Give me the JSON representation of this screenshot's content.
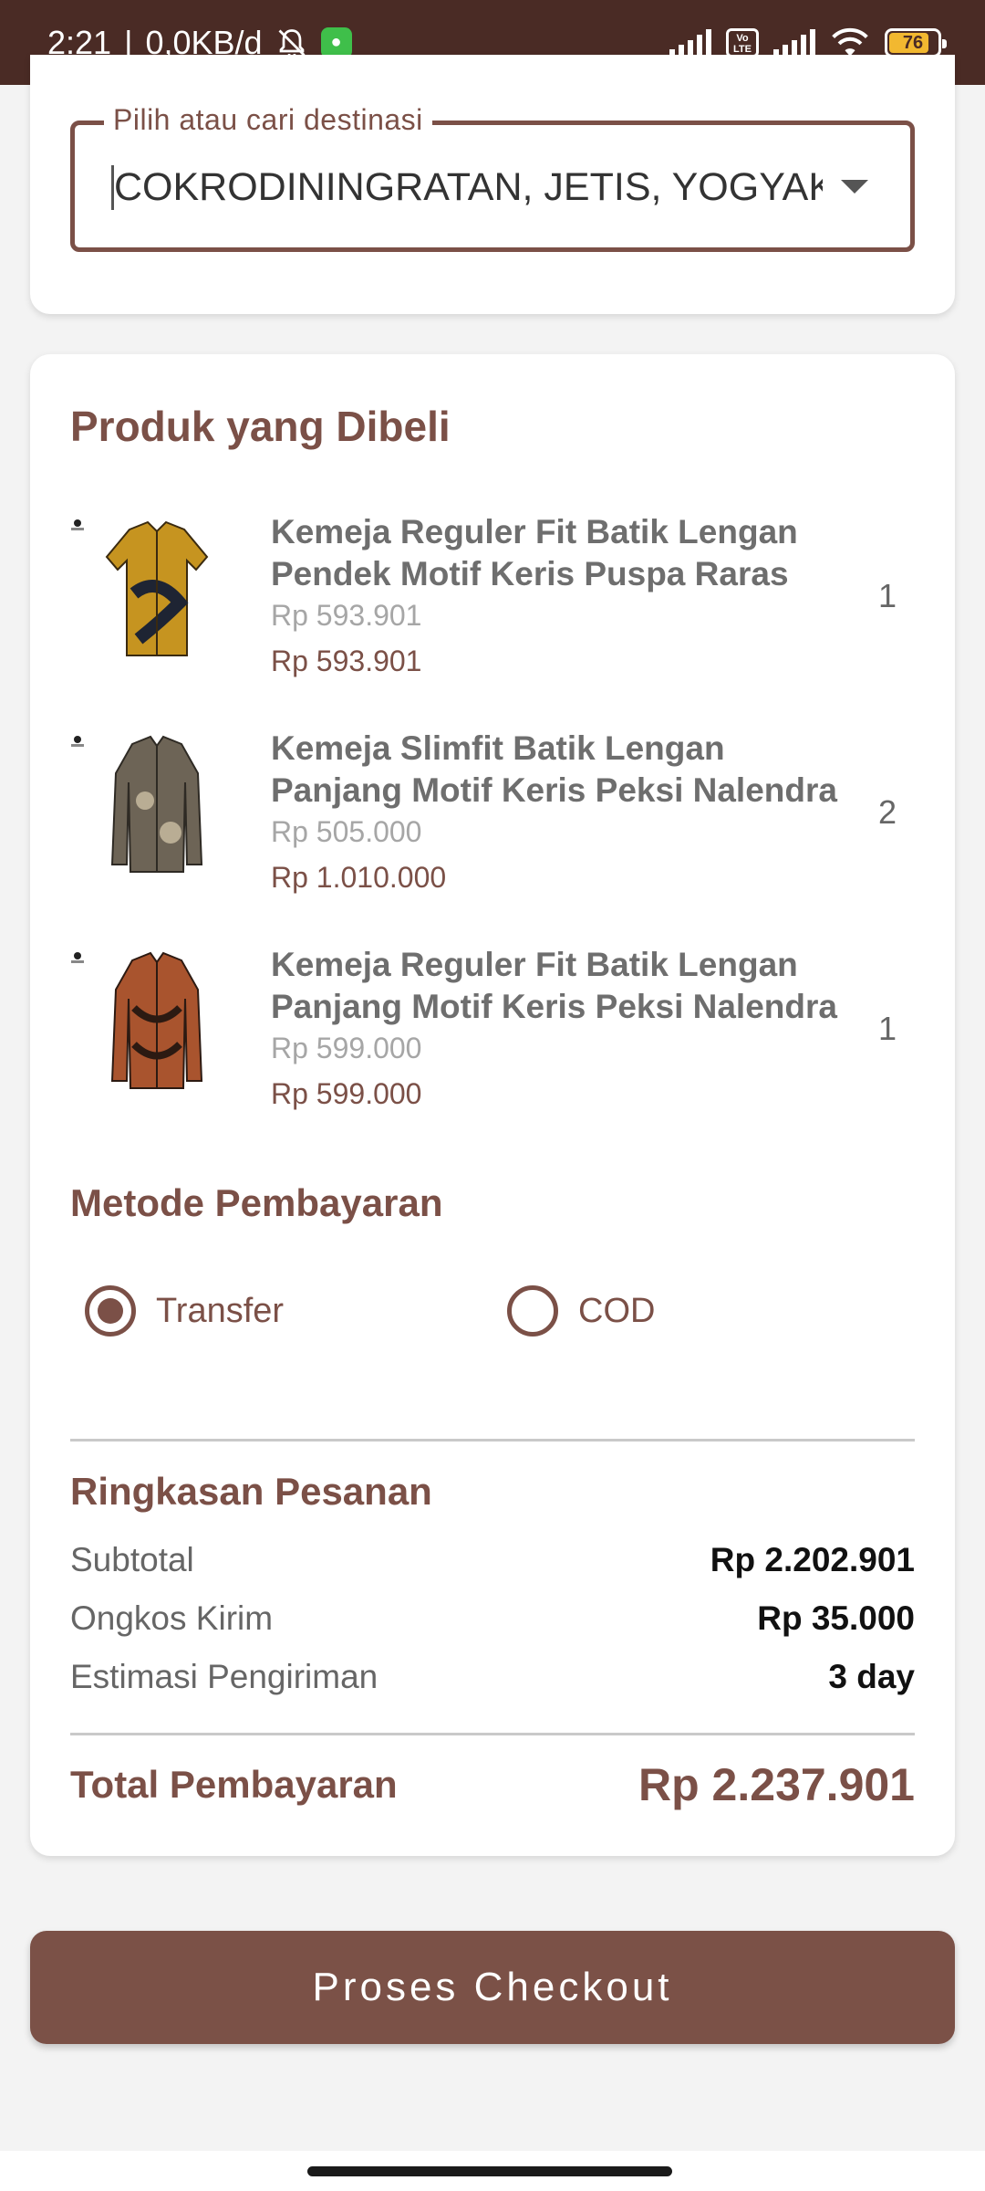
{
  "status_bar": {
    "time": "2:21",
    "separator": "|",
    "network_speed": "0,0KB/d",
    "battery_level": "76",
    "icons": [
      "bell-off-icon",
      "app-notification-icon",
      "signal-icon",
      "volte-icon",
      "signal-icon",
      "wifi-icon",
      "battery-icon"
    ]
  },
  "destination": {
    "label": "Pilih atau cari destinasi",
    "value": "COKRODININGRATAN, JETIS, YOGYAKARTA"
  },
  "products_section": {
    "title": "Produk yang Dibeli",
    "items": [
      {
        "name": "Kemeja Reguler Fit Batik Lengan Pendek Motif Keris Puspa Raras",
        "unit_price": "Rp 593.901",
        "total_price": "Rp 593.901",
        "quantity": "1",
        "color": "#c69420"
      },
      {
        "name": "Kemeja Slimfit Batik Lengan Panjang Motif Keris Peksi Nalendra",
        "unit_price": "Rp 505.000",
        "total_price": "Rp 1.010.000",
        "quantity": "2",
        "color": "#6d6456"
      },
      {
        "name": "Kemeja Reguler Fit Batik Lengan Panjang Motif Keris Peksi Nalendra",
        "unit_price": "Rp 599.000",
        "total_price": "Rp 599.000",
        "quantity": "1",
        "color": "#a9542e"
      }
    ]
  },
  "payment": {
    "title": "Metode Pembayaran",
    "options": [
      {
        "label": "Transfer",
        "selected": true
      },
      {
        "label": "COD",
        "selected": false
      }
    ]
  },
  "summary": {
    "title": "Ringkasan Pesanan",
    "rows": [
      {
        "label": "Subtotal",
        "value": "Rp 2.202.901"
      },
      {
        "label": "Ongkos Kirim",
        "value": "Rp 35.000"
      },
      {
        "label": "Estimasi Pengiriman",
        "value": "3 day"
      }
    ],
    "total_label": "Total Pembayaran",
    "total_value": "Rp 2.237.901"
  },
  "checkout_button": {
    "label": "Proses Checkout"
  },
  "colors": {
    "primary": "#7b5147",
    "status_bar": "#4a2b25"
  }
}
